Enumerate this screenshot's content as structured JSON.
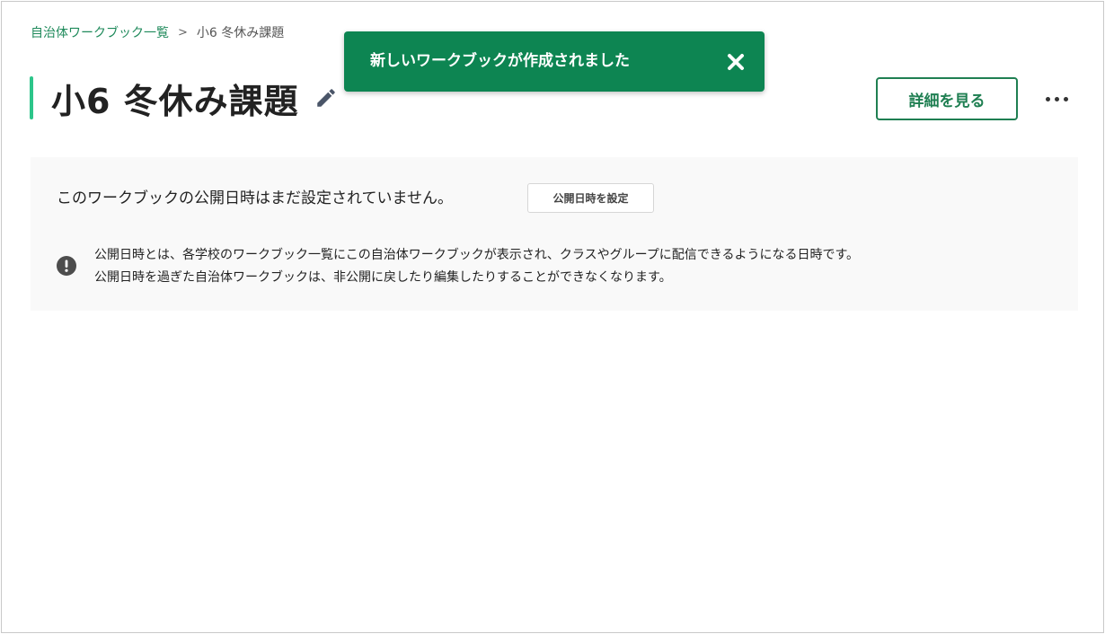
{
  "breadcrumb": {
    "parent": "自治体ワークブック一覧",
    "separator": ">",
    "current": "小6 冬休み課題"
  },
  "page": {
    "title": "小6 冬休み課題",
    "edit_icon": "pencil-icon",
    "accent_color": "#2dc58a"
  },
  "actions": {
    "detail_label": "詳細を見る",
    "more_icon": "more-horizontal-icon"
  },
  "toast": {
    "message": "新しいワークブックが作成されました",
    "close_icon": "close-icon",
    "background": "#0d8552"
  },
  "publish": {
    "status_text": "このワークブックの公開日時はまだ設定されていません。",
    "set_button_label": "公開日時を設定",
    "note_icon": "exclamation-circle-icon",
    "note_line1": "公開日時とは、各学校のワークブック一覧にこの自治体ワークブックが表示され、クラスやグループに配信できるようになる日時です。",
    "note_line2": "公開日時を過ぎた自治体ワークブックは、非公開に戻したり編集したりすることができなくなります。"
  }
}
